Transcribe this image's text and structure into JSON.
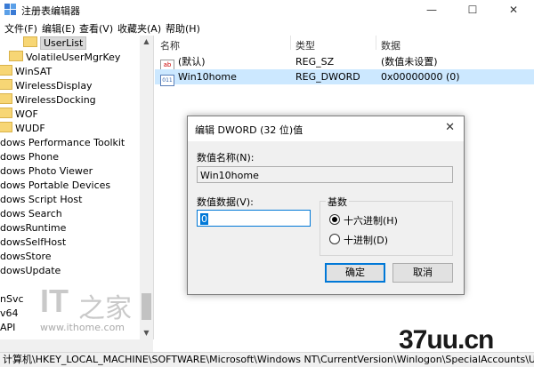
{
  "window": {
    "title": "注册表编辑器",
    "minimize": "—",
    "maximize": "☐",
    "close": "✕"
  },
  "menu": [
    "文件(F)",
    "编辑(E)",
    "查看(V)",
    "收藏夹(A)",
    "帮助(H)"
  ],
  "tree": {
    "items": [
      {
        "label": "UserList",
        "selected": true
      },
      {
        "label": "VolatileUserMgrKey",
        "selected": false
      },
      {
        "label": "WinSAT",
        "selected": false
      },
      {
        "label": "WirelessDisplay",
        "selected": false
      },
      {
        "label": "WirelessDocking",
        "selected": false
      },
      {
        "label": "WOF",
        "selected": false
      },
      {
        "label": "WUDF",
        "selected": false
      },
      {
        "label": "dows Performance Toolkit",
        "selected": false
      },
      {
        "label": "dows Phone",
        "selected": false
      },
      {
        "label": "dows Photo Viewer",
        "selected": false
      },
      {
        "label": "dows Portable Devices",
        "selected": false
      },
      {
        "label": "dows Script Host",
        "selected": false
      },
      {
        "label": "dows Search",
        "selected": false
      },
      {
        "label": "dowsRuntime",
        "selected": false
      },
      {
        "label": "dowsSelfHost",
        "selected": false
      },
      {
        "label": "dowsStore",
        "selected": false
      },
      {
        "label": "dowsUpdate",
        "selected": false
      },
      {
        "label": "nSvc",
        "selected": false
      },
      {
        "label": "v64",
        "selected": false
      },
      {
        "label": "API",
        "selected": false
      }
    ]
  },
  "list": {
    "columns": [
      "名称",
      "类型",
      "数据"
    ],
    "rows": [
      {
        "name": "(默认)",
        "type": "REG_SZ",
        "data": "(数值未设置)",
        "icon": "ab-string-icon",
        "selected": false
      },
      {
        "name": "Win10home",
        "type": "REG_DWORD",
        "data": "0x00000000 (0)",
        "icon": "binary-value-icon",
        "selected": true
      }
    ]
  },
  "status": {
    "path": "计算机\\HKEY_LOCAL_MACHINE\\SOFTWARE\\Microsoft\\Windows NT\\CurrentVersion\\Winlogon\\SpecialAccounts\\UserList"
  },
  "dialog": {
    "title": "编辑 DWORD (32 位)值",
    "close": "✕",
    "name_label": "数值名称(N):",
    "name_value": "Win10home",
    "data_label": "数值数据(V):",
    "data_value": "0",
    "base_label": "基数",
    "hex_label": "十六进制(H)",
    "dec_label": "十进制(D)",
    "base_selected": "hex",
    "ok": "确定",
    "cancel": "取消"
  },
  "watermarks": {
    "it_logo": "IT",
    "it_logo_cn": "之家",
    "site": "www.ithome.com",
    "site2": "37uu.cn"
  }
}
